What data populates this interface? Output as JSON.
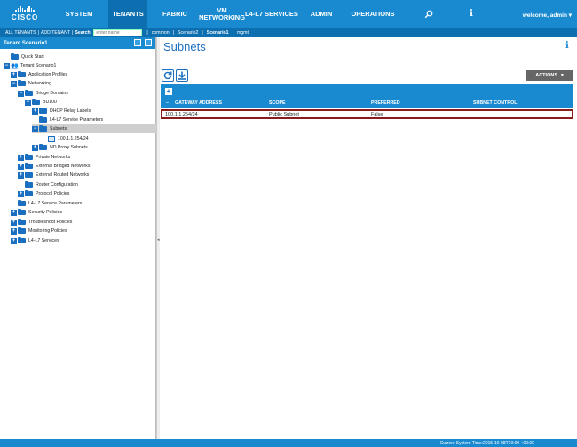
{
  "brand": {
    "logo_text": "CISCO"
  },
  "nav": {
    "items": [
      {
        "label": "SYSTEM"
      },
      {
        "label": "TENANTS"
      },
      {
        "label": "FABRIC"
      },
      {
        "label": "VM NETWORKING"
      },
      {
        "label": "L4-L7 SERVICES"
      },
      {
        "label": "ADMIN"
      },
      {
        "label": "OPERATIONS"
      }
    ],
    "active": "TENANTS",
    "info_label": "i",
    "welcome": "welcome, admin ▾"
  },
  "subnav": {
    "all_tenants": "ALL TENANTS",
    "add_tenant": "ADD TENANT",
    "search_label": "Search:",
    "search_placeholder": "enter name",
    "tenants": [
      "common",
      "Scenario2",
      "Scenario1",
      "mgmt"
    ],
    "current_tenant": "Scenario1"
  },
  "left_panel": {
    "title": "Tenant Scenario1",
    "tree": [
      {
        "label": "Quick Start"
      },
      {
        "label": "Tenant Scenario1"
      },
      {
        "label": "Application Profiles"
      },
      {
        "label": "Networking"
      },
      {
        "label": "Bridge Domains"
      },
      {
        "label": "BD100"
      },
      {
        "label": "DHCP Relay Labels"
      },
      {
        "label": "L4-L7 Service Parameters"
      },
      {
        "label": "Subnets"
      },
      {
        "label": "100.1.1.254/24"
      },
      {
        "label": "ND Proxy Subnets"
      },
      {
        "label": "Private Networks"
      },
      {
        "label": "External Bridged Networks"
      },
      {
        "label": "External Routed Networks"
      },
      {
        "label": "Router Configuration"
      },
      {
        "label": "Protocol Policies"
      },
      {
        "label": "L4-L7 Service Parameters"
      },
      {
        "label": "Security Policies"
      },
      {
        "label": "Troubleshoot Policies"
      },
      {
        "label": "Monitoring Policies"
      },
      {
        "label": "L4-L7 Services"
      }
    ],
    "selected": "Subnets"
  },
  "main": {
    "title": "Subnets",
    "info_label": "i",
    "actions_label": "ACTIONS",
    "table": {
      "columns": [
        "GATEWAY ADDRESS",
        "SCOPE",
        "PREFERRED",
        "SUBNET CONTROL"
      ],
      "rows": [
        {
          "gateway": "100.1.1.254/24",
          "scope": "Public Subnet",
          "preferred": "False",
          "subnet_control": ""
        }
      ]
    }
  },
  "footer": {
    "status": "Current System Time:2015-10-08T10:00 +00:00"
  },
  "colors": {
    "primary": "#1a8ad0",
    "dark": "#0d6fb0",
    "highlight_border": "#8b1a1a"
  }
}
